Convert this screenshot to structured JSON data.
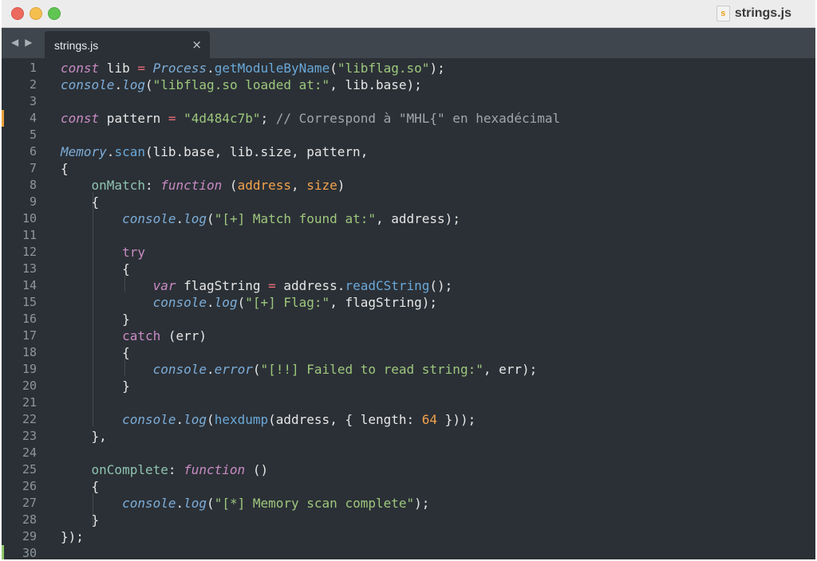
{
  "window": {
    "title": "strings.js",
    "icon": "js-file-icon"
  },
  "tabs": [
    {
      "label": "strings.js",
      "close_glyph": "×",
      "active": true
    }
  ],
  "nav": {
    "back": "◀",
    "forward": "▶"
  },
  "colors": {
    "background": "#2b3036",
    "tabbar": "#3f464d",
    "keyword": "#c98bc4",
    "function": "#6aa8d8",
    "string": "#9ec77d",
    "number": "#f2a24c",
    "comment": "#a0a6ac",
    "operator": "#e86d78",
    "modified_marker": "#e8a23a",
    "saved_marker": "#8fc76a"
  },
  "lines": [
    {
      "n": "1",
      "tokens": [
        [
          "kw",
          "const"
        ],
        [
          "plain",
          " lib "
        ],
        [
          "op",
          "="
        ],
        [
          "plain",
          " "
        ],
        [
          "cls",
          "Process"
        ],
        [
          "plain",
          "."
        ],
        [
          "fn",
          "getModuleByName"
        ],
        [
          "plain",
          "("
        ],
        [
          "str",
          "\"libflag.so\""
        ],
        [
          "plain",
          ");"
        ]
      ]
    },
    {
      "n": "2",
      "tokens": [
        [
          "cls",
          "console"
        ],
        [
          "plain",
          "."
        ],
        [
          "cls",
          "log"
        ],
        [
          "plain",
          "("
        ],
        [
          "str",
          "\"libflag.so loaded at:\""
        ],
        [
          "plain",
          ", lib.base);"
        ]
      ]
    },
    {
      "n": "3",
      "tokens": []
    },
    {
      "n": "4",
      "marker": "modified",
      "tokens": [
        [
          "kw",
          "const"
        ],
        [
          "plain",
          " pattern "
        ],
        [
          "op",
          "="
        ],
        [
          "plain",
          " "
        ],
        [
          "str",
          "\"4d484c7b\""
        ],
        [
          "plain",
          "; "
        ],
        [
          "com",
          "// Correspond à \"MHL{\" en hexadécimal"
        ]
      ]
    },
    {
      "n": "5",
      "tokens": []
    },
    {
      "n": "6",
      "tokens": [
        [
          "cls",
          "Memory"
        ],
        [
          "plain",
          "."
        ],
        [
          "fn",
          "scan"
        ],
        [
          "plain",
          "(lib.base, lib.size, pattern,"
        ]
      ]
    },
    {
      "n": "7",
      "tokens": [
        [
          "plain",
          "{"
        ]
      ]
    },
    {
      "n": "8",
      "tokens": [
        [
          "plain",
          "    "
        ],
        [
          "prop",
          "onMatch"
        ],
        [
          "plain",
          ": "
        ],
        [
          "kw",
          "function"
        ],
        [
          "plain",
          " ("
        ],
        [
          "param",
          "address"
        ],
        [
          "plain",
          ", "
        ],
        [
          "param",
          "size"
        ],
        [
          "plain",
          ")"
        ]
      ]
    },
    {
      "n": "9",
      "tokens": [
        [
          "plain",
          "    {"
        ]
      ]
    },
    {
      "n": "10",
      "tokens": [
        [
          "plain",
          "        "
        ],
        [
          "cls",
          "console"
        ],
        [
          "plain",
          "."
        ],
        [
          "cls",
          "log"
        ],
        [
          "plain",
          "("
        ],
        [
          "str",
          "\"[+] Match found at:\""
        ],
        [
          "plain",
          ", address);"
        ]
      ]
    },
    {
      "n": "11",
      "tokens": []
    },
    {
      "n": "12",
      "tokens": [
        [
          "plain",
          "        "
        ],
        [
          "kw2",
          "try"
        ]
      ]
    },
    {
      "n": "13",
      "tokens": [
        [
          "plain",
          "        {"
        ]
      ]
    },
    {
      "n": "14",
      "tokens": [
        [
          "plain",
          "            "
        ],
        [
          "kw",
          "var"
        ],
        [
          "plain",
          " flagString "
        ],
        [
          "op",
          "="
        ],
        [
          "plain",
          " address."
        ],
        [
          "fn",
          "readCString"
        ],
        [
          "plain",
          "();"
        ]
      ]
    },
    {
      "n": "15",
      "tokens": [
        [
          "plain",
          "            "
        ],
        [
          "cls",
          "console"
        ],
        [
          "plain",
          "."
        ],
        [
          "cls",
          "log"
        ],
        [
          "plain",
          "("
        ],
        [
          "str",
          "\"[+] Flag:\""
        ],
        [
          "plain",
          ", flagString);"
        ]
      ]
    },
    {
      "n": "16",
      "tokens": [
        [
          "plain",
          "        }"
        ]
      ]
    },
    {
      "n": "17",
      "tokens": [
        [
          "plain",
          "        "
        ],
        [
          "kw2",
          "catch"
        ],
        [
          "plain",
          " (err)"
        ]
      ]
    },
    {
      "n": "18",
      "tokens": [
        [
          "plain",
          "        {"
        ]
      ]
    },
    {
      "n": "19",
      "tokens": [
        [
          "plain",
          "            "
        ],
        [
          "cls",
          "console"
        ],
        [
          "plain",
          "."
        ],
        [
          "cls",
          "error"
        ],
        [
          "plain",
          "("
        ],
        [
          "str",
          "\"[!!] Failed to read string:\""
        ],
        [
          "plain",
          ", err);"
        ]
      ]
    },
    {
      "n": "20",
      "tokens": [
        [
          "plain",
          "        }"
        ]
      ]
    },
    {
      "n": "21",
      "tokens": []
    },
    {
      "n": "22",
      "tokens": [
        [
          "plain",
          "        "
        ],
        [
          "cls",
          "console"
        ],
        [
          "plain",
          "."
        ],
        [
          "cls",
          "log"
        ],
        [
          "plain",
          "("
        ],
        [
          "fn",
          "hexdump"
        ],
        [
          "plain",
          "(address, { length: "
        ],
        [
          "num",
          "64"
        ],
        [
          "plain",
          " }));"
        ]
      ]
    },
    {
      "n": "23",
      "tokens": [
        [
          "plain",
          "    },"
        ]
      ]
    },
    {
      "n": "24",
      "tokens": []
    },
    {
      "n": "25",
      "tokens": [
        [
          "plain",
          "    "
        ],
        [
          "prop",
          "onComplete"
        ],
        [
          "plain",
          ": "
        ],
        [
          "kw",
          "function"
        ],
        [
          "plain",
          " ()"
        ]
      ]
    },
    {
      "n": "26",
      "tokens": [
        [
          "plain",
          "    {"
        ]
      ]
    },
    {
      "n": "27",
      "tokens": [
        [
          "plain",
          "        "
        ],
        [
          "cls",
          "console"
        ],
        [
          "plain",
          "."
        ],
        [
          "cls",
          "log"
        ],
        [
          "plain",
          "("
        ],
        [
          "str",
          "\"[*] Memory scan complete\""
        ],
        [
          "plain",
          ");"
        ]
      ]
    },
    {
      "n": "28",
      "tokens": [
        [
          "plain",
          "    }"
        ]
      ]
    },
    {
      "n": "29",
      "tokens": [
        [
          "plain",
          "});"
        ]
      ]
    },
    {
      "n": "30",
      "marker": "saved",
      "tokens": []
    }
  ]
}
